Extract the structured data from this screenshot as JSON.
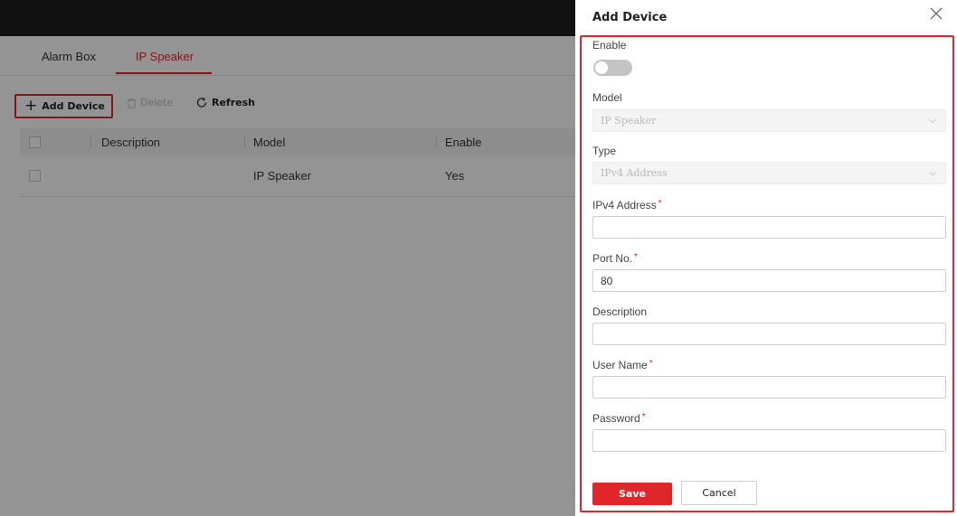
{
  "tabs": [
    {
      "label": "Alarm Box",
      "active": false
    },
    {
      "label": "IP Speaker",
      "active": true
    }
  ],
  "toolbar": {
    "add_label": "Add Device",
    "delete_label": "Delete",
    "refresh_label": "Refresh"
  },
  "table": {
    "columns": [
      "Description",
      "Model",
      "Enable"
    ],
    "rows": [
      {
        "description": "",
        "model": "IP Speaker",
        "enable": "Yes"
      }
    ]
  },
  "drawer": {
    "title": "Add Device",
    "enable_label": "Enable",
    "enable_value": false,
    "model_label": "Model",
    "model_value": "IP Speaker",
    "type_label": "Type",
    "type_value": "IPv4 Address",
    "ipv4_label": "IPv4 Address",
    "ipv4_value": "",
    "port_label": "Port No.",
    "port_value": "80",
    "description_label": "Description",
    "description_value": "",
    "username_label": "User Name",
    "username_value": "",
    "password_label": "Password",
    "password_value": "",
    "required_mark": "*",
    "save_label": "Save",
    "cancel_label": "Cancel"
  },
  "colors": {
    "accent": "#e0252b",
    "topbar": "#1f1f1f"
  }
}
